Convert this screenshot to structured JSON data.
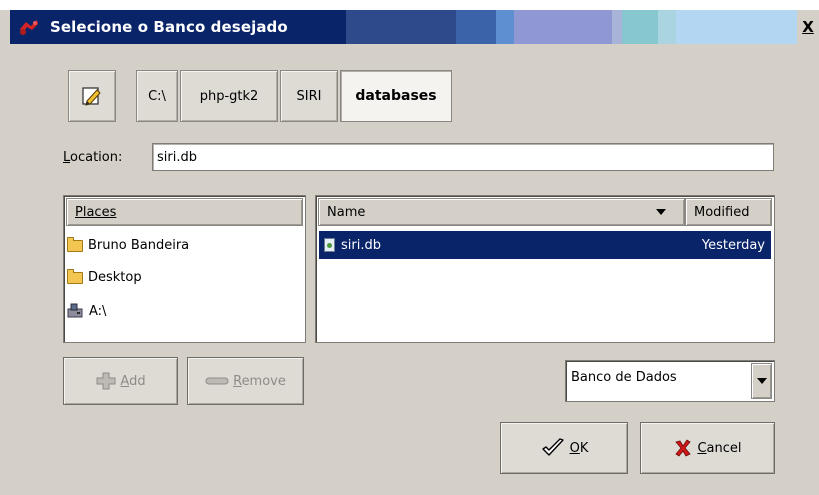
{
  "window": {
    "title": "Selecione o Banco desejado",
    "close_label": "X"
  },
  "pathbar": {
    "segments": [
      {
        "label": "C:\\"
      },
      {
        "label": "php-gtk2"
      },
      {
        "label": "SIRI"
      },
      {
        "label": "databases"
      }
    ]
  },
  "location": {
    "label_first": "L",
    "label_rest": "ocation:",
    "value": "siri.db"
  },
  "places": {
    "header": "Places",
    "items": [
      {
        "label": "Bruno Bandeira",
        "icon": "folder-icon"
      },
      {
        "label": "Desktop",
        "icon": "folder-icon"
      },
      {
        "label": "A:\\",
        "icon": "floppy-drive-icon"
      }
    ]
  },
  "files": {
    "columns": {
      "name": "Name",
      "modified": "Modified"
    },
    "rows": [
      {
        "name": "siri.db",
        "modified": "Yesterday",
        "selected": true
      }
    ]
  },
  "buttons": {
    "add_first": "A",
    "add_rest": "dd",
    "remove_first": "R",
    "remove_rest": "emove",
    "ok_first": "O",
    "ok_rest": "K",
    "cancel_first": "C",
    "cancel_rest": "ancel"
  },
  "filter": {
    "selected": "Banco de Dados"
  },
  "colors": {
    "title_bar": "#0a246a",
    "selection": "#0a246a",
    "dialog_bg": "#d4d0c8"
  }
}
